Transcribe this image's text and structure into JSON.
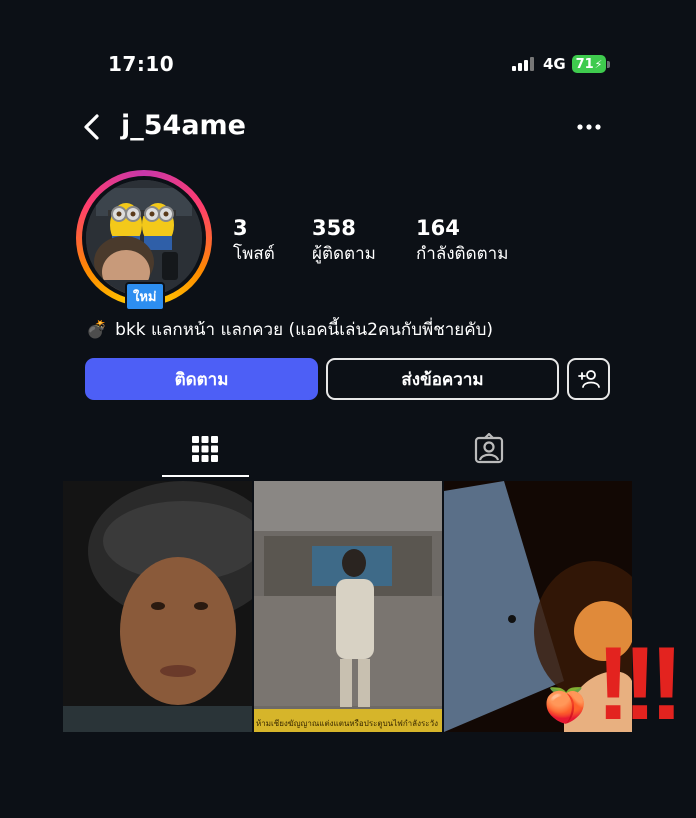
{
  "status_bar": {
    "time": "17:10",
    "network": "4G",
    "battery": "71"
  },
  "header": {
    "username": "j_54ame"
  },
  "profile": {
    "new_badge": "ใหม่",
    "stats": [
      {
        "value": "3",
        "label": "โพสต์"
      },
      {
        "value": "358",
        "label": "ผู้ติดตาม"
      },
      {
        "value": "164",
        "label": "กำลังติดตาม"
      }
    ],
    "bio_emoji": "💣",
    "bio": "bkk แลกหน้า แลกควย (แอคนี้เล่น2คนกับพี่ชายคับ)"
  },
  "actions": {
    "follow": "ติดตาม",
    "message": "ส่งข้อความ"
  },
  "tabs": [
    {
      "icon": "grid-icon",
      "active": true
    },
    {
      "icon": "tagged-icon",
      "active": false
    }
  ],
  "posts": [
    {
      "icon": "photo"
    },
    {
      "icon": "photo",
      "caption_strip": "ห้ามเชียงฆัญญาณแต่งแตนหรือประตูบนไฟกำลังระวัง"
    },
    {
      "icon": "photo",
      "emoji": "🍑",
      "overlay": "!!!"
    }
  ],
  "colors": {
    "accent": "#4d5ff6",
    "battery": "#3fcb4e",
    "badge": "#2d8ef0",
    "overlay": "#e3231f"
  }
}
